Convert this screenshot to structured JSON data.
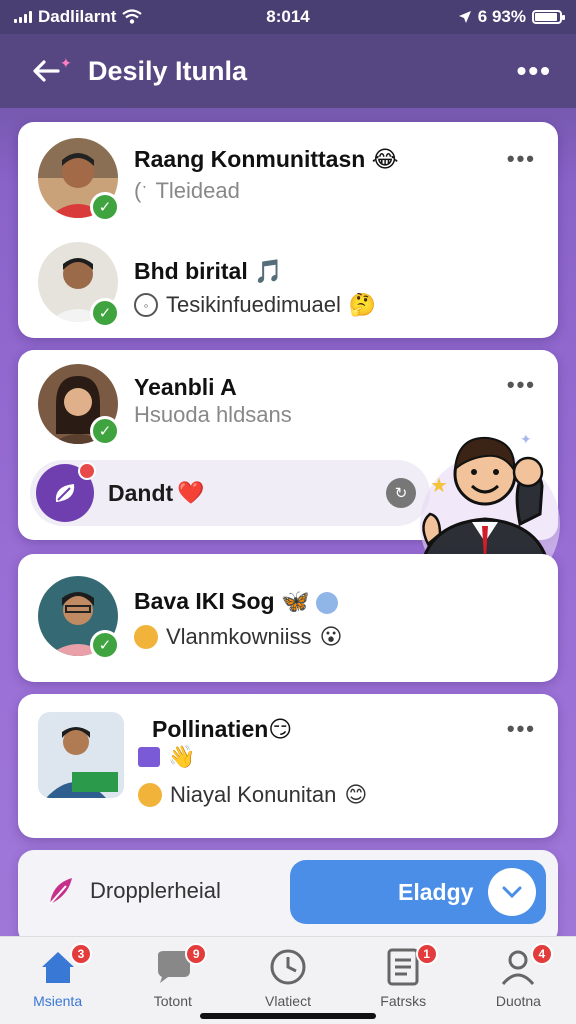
{
  "status_bar": {
    "carrier": "Dadlilarnt",
    "time": "8:014",
    "battery": "6 93%",
    "battery_level": 0.93
  },
  "header": {
    "title": "Desily Itunla",
    "back_icon": "arrow-left-icon",
    "more_icon": "more-horizontal-icon"
  },
  "chats": [
    {
      "name": "Raang Konmunittasn",
      "subtitle": "Tleidead",
      "name_emoji": "😂",
      "sub_icon": "call-icon"
    },
    {
      "name": "Bhd birital",
      "subtitle": "Tesikinfuedimuael",
      "name_emoji": "🎵",
      "sub_emoji": "🤔",
      "sub_icon": "message-icon"
    },
    {
      "name": "Yeanbli A",
      "subtitle": "Hsuoda hldsans"
    },
    {
      "name": "Bava IKI Sog",
      "subtitle": "Vlanmkowniiss",
      "name_emoji": "🦋",
      "sub_emoji": "😮",
      "sub_icon": "badge-icon"
    },
    {
      "name": "Pollinatien",
      "subtitle": "Niayal Konunitan",
      "name_emoji": "😏",
      "sub_emoji": "😊",
      "extra_emoji": "👋"
    }
  ],
  "dandi": {
    "label": "Dandt",
    "emoji": "❤️"
  },
  "promo": {
    "label": "Dropplerheial",
    "button": "Eladgy"
  },
  "tabs": [
    {
      "label": "Msienta",
      "icon": "home-icon",
      "badge": "3",
      "active": true
    },
    {
      "label": "Totont",
      "icon": "chat-bubble-icon",
      "badge": "9"
    },
    {
      "label": "Vlatiect",
      "icon": "clock-icon",
      "badge": ""
    },
    {
      "label": "Fatrsks",
      "icon": "list-icon",
      "badge": "1"
    },
    {
      "label": "Duotna",
      "icon": "user-icon",
      "badge": "4"
    }
  ],
  "colors": {
    "accent": "#4a8ee8",
    "header": "#564783",
    "online": "#3fa43f",
    "badge": "#e23c3c"
  }
}
